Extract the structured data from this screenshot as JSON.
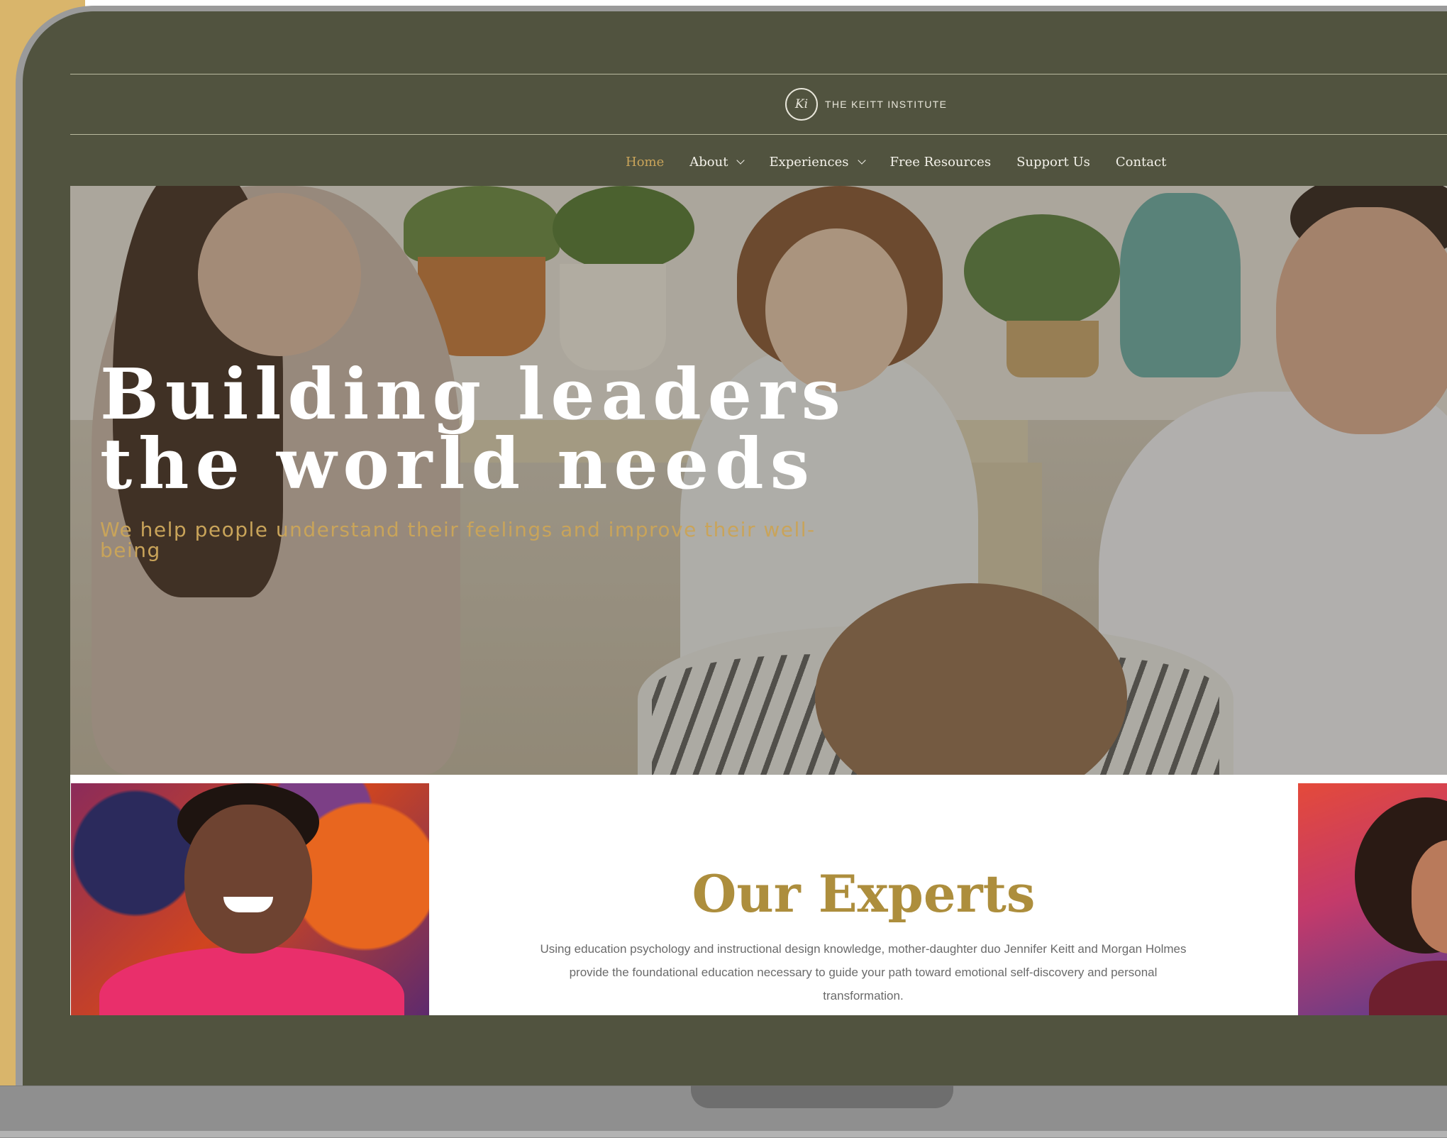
{
  "site": {
    "logo_mark": "Ki",
    "logo_text": "THE KEITT INSTITUTE"
  },
  "nav": {
    "items": [
      {
        "label": "Home",
        "active": true,
        "has_dropdown": false
      },
      {
        "label": "About",
        "active": false,
        "has_dropdown": true
      },
      {
        "label": "Experiences",
        "active": false,
        "has_dropdown": true
      },
      {
        "label": "Free Resources",
        "active": false,
        "has_dropdown": false
      },
      {
        "label": "Support Us",
        "active": false,
        "has_dropdown": false
      },
      {
        "label": "Contact",
        "active": false,
        "has_dropdown": false
      }
    ]
  },
  "hero": {
    "title_line1": "Building leaders",
    "title_line2": "the world needs",
    "subtitle": "We help people understand their feelings and improve their well-being"
  },
  "experts": {
    "title": "Our Experts",
    "description": "Using education psychology and instructional design knowledge, mother-daughter duo Jennifer Keitt and Morgan Holmes provide the foundational education necessary to guide your path toward emotional self-discovery and personal transformation."
  },
  "colors": {
    "nav_bg": "#51533f",
    "accent_gold": "#c9a45a",
    "experts_title": "#ad8e3d",
    "frame_gold": "#d9b56b"
  },
  "icons": {
    "dropdown": "chevron-down-icon",
    "logo": "monogram-circle-logo"
  }
}
